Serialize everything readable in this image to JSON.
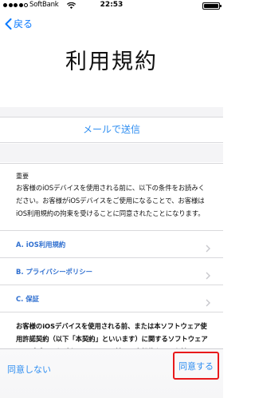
{
  "status_bar": {
    "carrier": "SoftBank",
    "time": "22:53",
    "signal_bars_filled": 4,
    "signal_bars_total": 5,
    "battery_level": 1.0
  },
  "nav": {
    "back_label": "戻る"
  },
  "page": {
    "title": "利用規約"
  },
  "actions": {
    "send_mail_label": "メールで送信"
  },
  "notice": {
    "heading": "重要",
    "body": "お客様のiOSデバイスを使用される前に、以下の条件をお読みください。お客様がiOSデバイスをご使用になることで、お客様はiOS利用規約の拘束を受けることに同意されたことになります。"
  },
  "links": [
    {
      "label": "A. iOS利用規約"
    },
    {
      "label": "B. プライバシーポリシー"
    },
    {
      "label": "C. 保証"
    }
  ],
  "bottom_text": "お客様のiOSデバイスを使用される前、または本ソフトウェア使用許諾契約（以下「本契約」といいます）に関するソフトウェアアップデートをダウンロードする前に、本契約をよくお読みください。iOSデバイスをご使用になることで、またはソフトウェアアップデートをダウンロードすることで",
  "toolbar": {
    "disagree_label": "同意しない",
    "agree_label": "同意する"
  },
  "colors": {
    "accent": "#2f8ef1",
    "link": "#2f6fd0",
    "highlight": "#e8191b"
  }
}
